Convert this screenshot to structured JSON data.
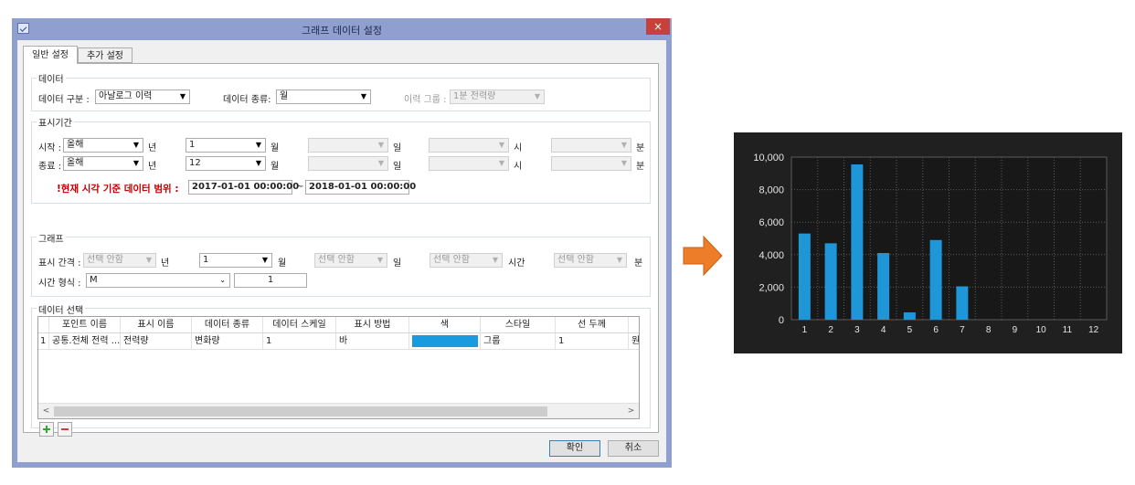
{
  "window": {
    "title": "그래프 데이터 설정",
    "close_label": "×"
  },
  "tabs": [
    {
      "label": "일반 설정",
      "active": true
    },
    {
      "label": "추가 설정",
      "active": false
    }
  ],
  "data_group": {
    "label": "데이터",
    "category_label": "데이터 구분 :",
    "category_value": "아날로그 이력",
    "kind_label": "데이터 종류:",
    "kind_value": "월",
    "history_group_label": "이력 그룹 :",
    "history_group_value": "1분 전력량"
  },
  "period_group": {
    "label": "표시기간",
    "start_label": "시작 :",
    "start_year": "올해",
    "start_month": "1",
    "end_label": "종료 :",
    "end_year": "올해",
    "end_month": "12",
    "unit_year": "년",
    "unit_month": "월",
    "unit_day": "일",
    "unit_hour": "시",
    "unit_minute": "분",
    "range_label": "!현재 시각 기준 데이터 범위 :",
    "range_start": "2017-01-01 00:00:00",
    "range_sep": "~",
    "range_end": "2018-01-01 00:00:00"
  },
  "graph_group": {
    "label": "그래프",
    "interval_label": "표시 간격 :",
    "interval_year": "선택 안함",
    "unit_year": "년",
    "interval_month": "1",
    "unit_month": "월",
    "interval_day": "선택 안함",
    "unit_day": "일",
    "interval_hour": "선택 안함",
    "unit_hour": "시간",
    "interval_minute": "선택 안함",
    "unit_minute": "분",
    "time_format_label": "시간 형식 :",
    "time_format_value": "M",
    "time_format_extra": "1"
  },
  "select_group": {
    "label": "데이터 선택",
    "columns": [
      "포인트 이름",
      "표시 이름",
      "데이터 종류",
      "데이터 스케일",
      "표시 방법",
      "색",
      "스타일",
      "선 두께"
    ],
    "rows": [
      {
        "index": "1",
        "point_name": "공통.전체 전력 ...",
        "display_name": "전력량",
        "data_kind": "변화량",
        "scale": "1",
        "method": "바",
        "color": "#1a9be0",
        "style": "그룹",
        "thickness": "1",
        "extra": "원"
      }
    ]
  },
  "buttons": {
    "ok": "확인",
    "cancel": "취소"
  },
  "chart_data": {
    "type": "bar",
    "categories": [
      "1",
      "2",
      "3",
      "4",
      "5",
      "6",
      "7",
      "8",
      "9",
      "10",
      "11",
      "12"
    ],
    "values": [
      5300,
      4700,
      9550,
      4100,
      450,
      4900,
      2050,
      0,
      0,
      0,
      0,
      0
    ],
    "ylim": [
      0,
      10000
    ],
    "yticks": [
      "0",
      "2,000",
      "4,000",
      "6,000",
      "8,000",
      "10,000"
    ],
    "grid": true,
    "colors": {
      "bar": "#1e96d8",
      "background": "#202020",
      "plot": "#181818",
      "text": "#e6e6e6"
    }
  }
}
